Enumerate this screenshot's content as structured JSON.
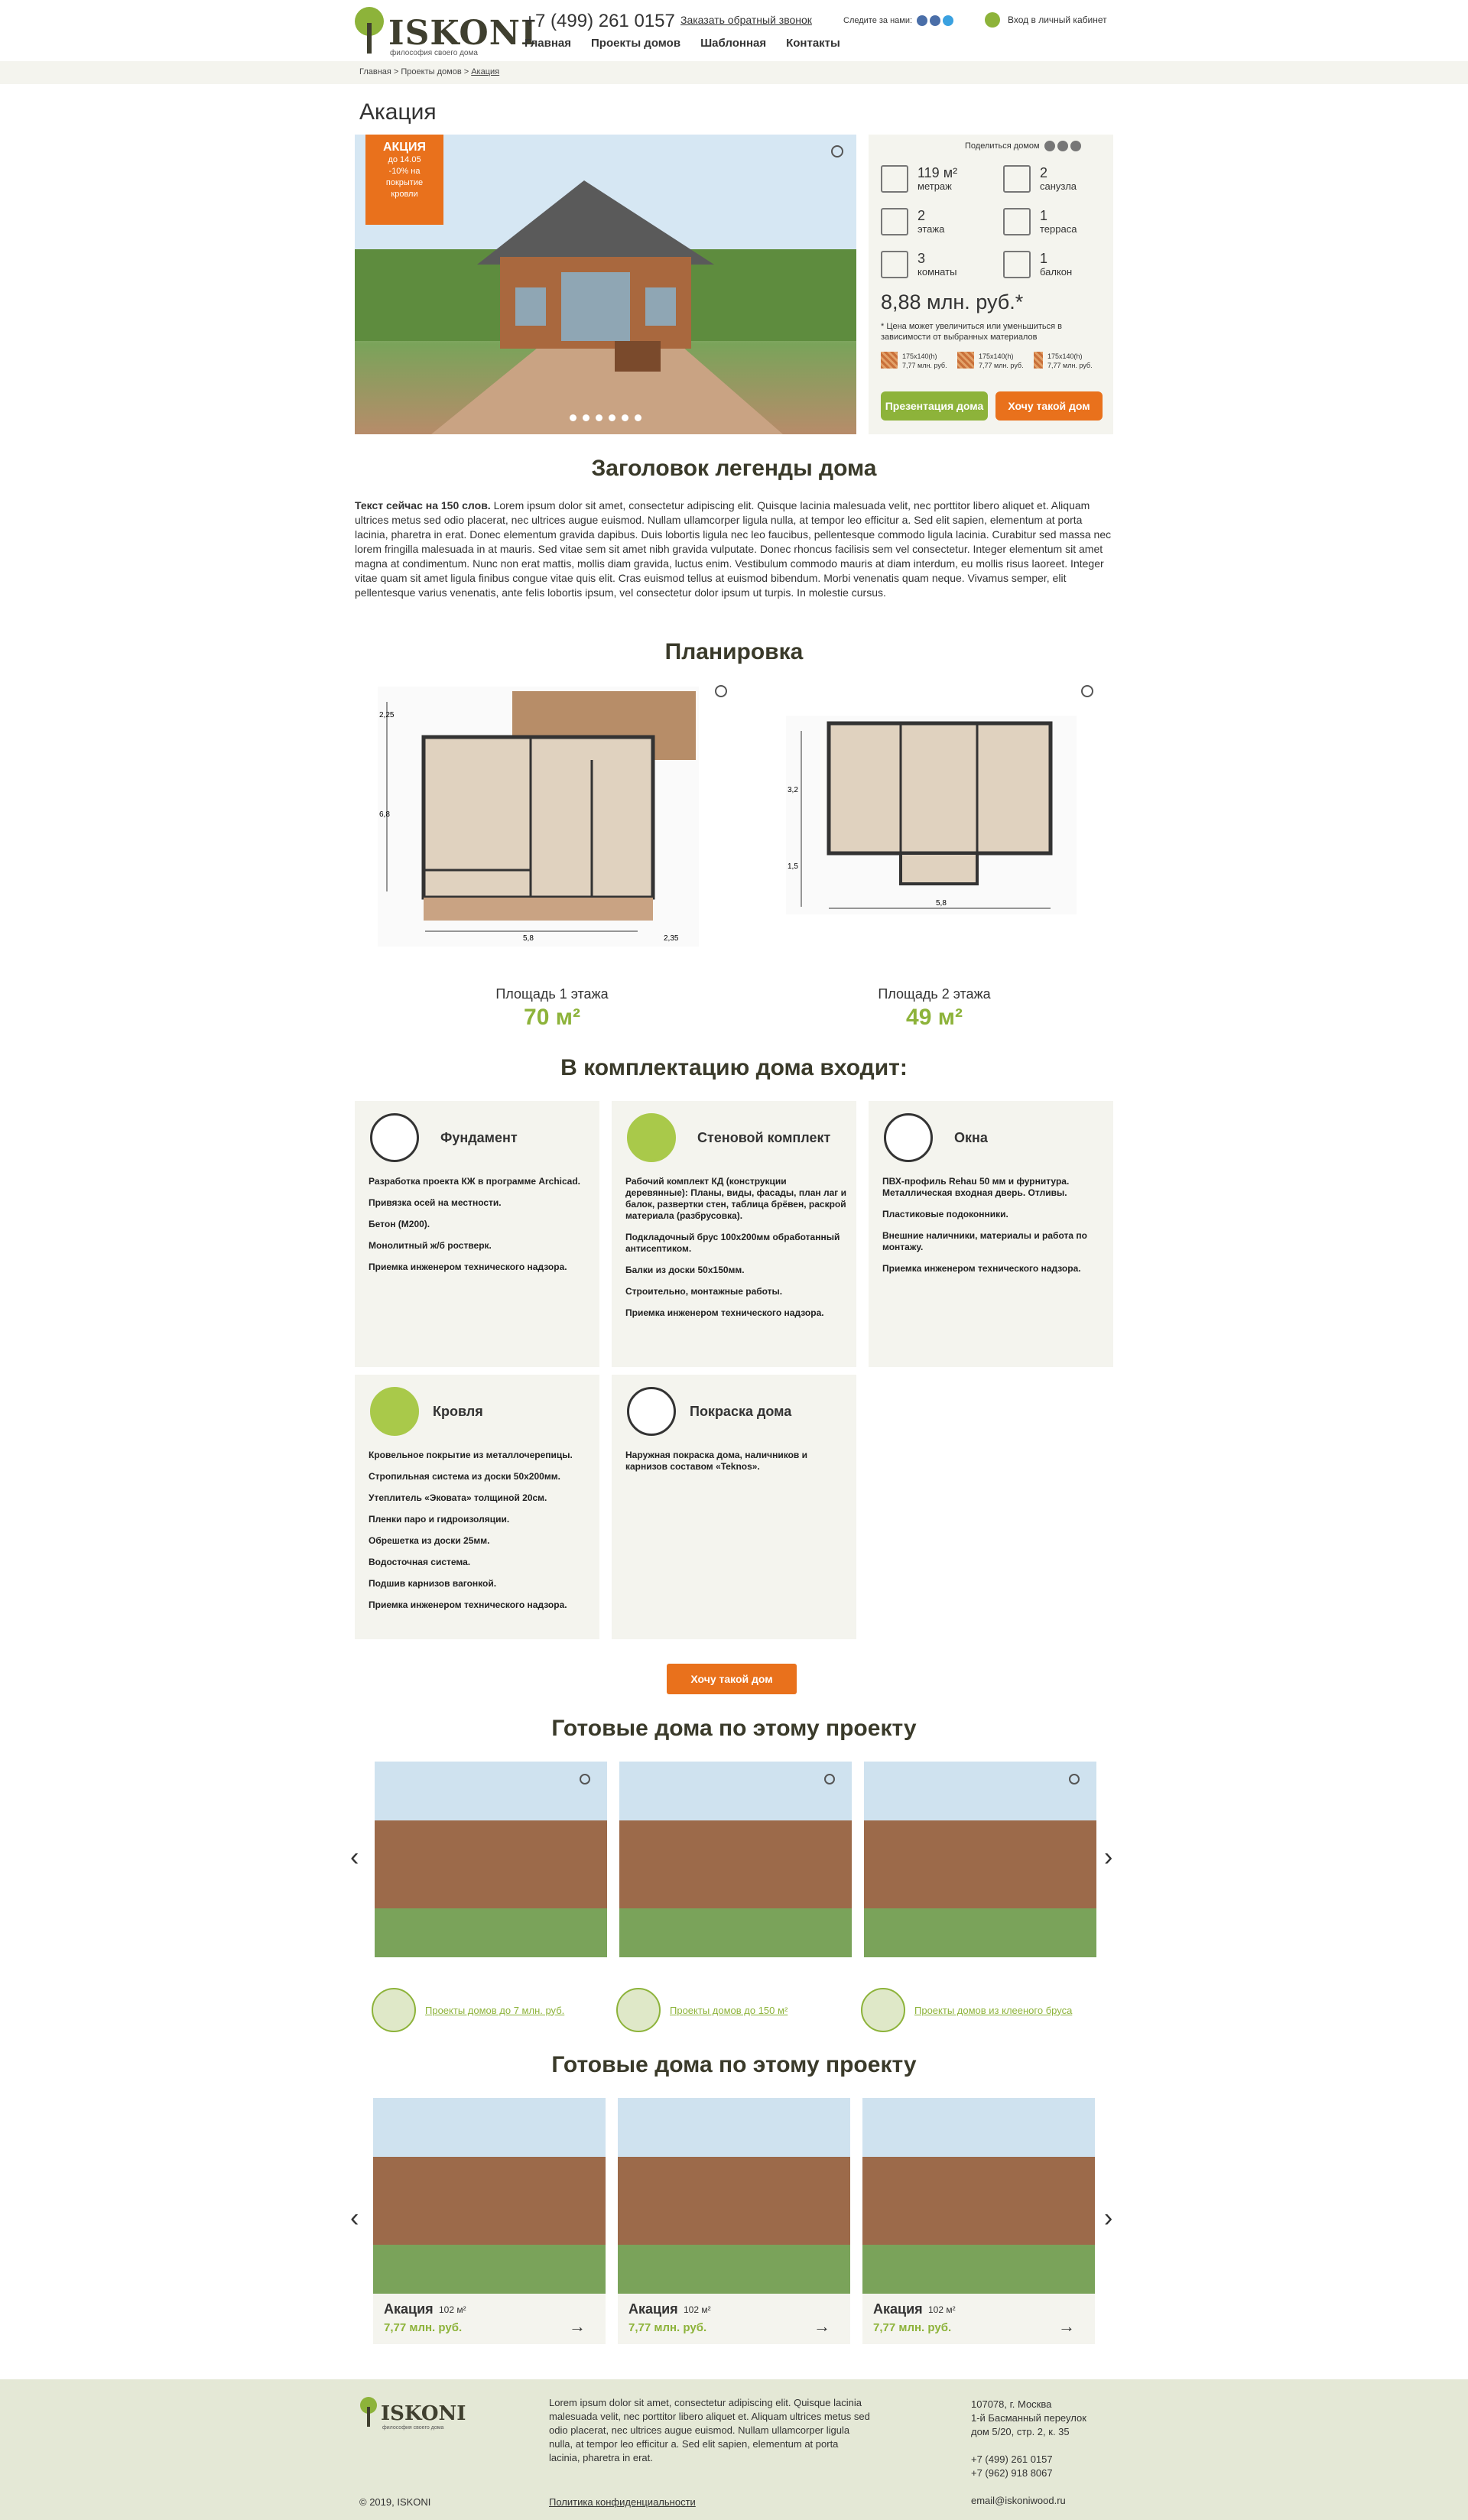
{
  "header": {
    "logo": "ISKONI",
    "logo_sub": "философия своего дома",
    "phone": "+7 (499) 261 0157",
    "callback": "Заказать обратный звонок",
    "nav": [
      "Главная",
      "Проекты домов",
      "Шаблонная",
      "Контакты"
    ],
    "follow": "Следите за нами:",
    "cabinet": "Вход в личный кабинет"
  },
  "breadcrumbs": {
    "path": "Главная > Проекты домов > ",
    "current": "Акация"
  },
  "title": "Акация",
  "promo": {
    "label": "АКЦИЯ",
    "line1": "до 14.05",
    "line2": "-10% на",
    "line3": "покрытие",
    "line4": "кровли"
  },
  "share": "Поделиться домом",
  "specs": [
    {
      "value": "119 м²",
      "label": "метраж",
      "icon": "area-icon"
    },
    {
      "value": "2",
      "label": "санузла",
      "icon": "toilet-icon"
    },
    {
      "value": "2",
      "label": "этажа",
      "icon": "floors-icon"
    },
    {
      "value": "1",
      "label": "терраса",
      "icon": "terrace-icon"
    },
    {
      "value": "3",
      "label": "комнаты",
      "icon": "rooms-icon"
    },
    {
      "value": "1",
      "label": "балкон",
      "icon": "balcony-icon"
    }
  ],
  "price": "8,88 млн. руб.*",
  "price_note": "* Цена может увеличиться или уменьшиться в зависимости от выбранных материалов",
  "materials": [
    {
      "size": "175х140(h)",
      "price": "7,77 млн. руб."
    },
    {
      "size": "175х140(h)",
      "price": "7,77 млн. руб."
    },
    {
      "size": "175х140(h)",
      "price": "7,77 млн. руб."
    }
  ],
  "buttons": {
    "presentation": "Презентация дома",
    "want": "Хочу такой дом",
    "want2": "Хочу такой дом"
  },
  "legend": {
    "heading": "Заголовок легенды дома",
    "lead": "Текст сейчас на 150 слов.",
    "text": " Lorem ipsum dolor sit amet, consectetur adipiscing elit. Quisque lacinia malesuada velit, nec porttitor libero aliquet et. Aliquam ultrices metus sed odio placerat, nec ultrices augue euismod. Nullam ullamcorper ligula nulla, at tempor leo efficitur a. Sed elit sapien, elementum at porta lacinia, pharetra in erat. Donec elementum gravida dapibus. Duis lobortis ligula nec leo faucibus, pellentesque commodo ligula lacinia. Curabitur sed massa nec lorem fringilla malesuada in at mauris. Sed vitae sem sit amet nibh gravida vulputate. Donec rhoncus facilisis sem vel consectetur. Integer elementum sit amet magna at condimentum. Nunc non erat mattis, mollis diam gravida, luctus enim. Vestibulum commodo mauris at diam interdum, eu mollis risus laoreet. Integer vitae quam sit amet ligula finibus congue vitae quis elit. Cras euismod tellus at euismod bibendum. Morbi venenatis quam neque. Vivamus semper, elit pellentesque varius venenatis, ante felis lobortis ipsum, vel consectetur dolor ipsum ut turpis. In molestie cursus."
  },
  "plan": {
    "heading": "Планировка",
    "floor1_label": "Площадь 1 этажа",
    "floor1_value": "70 м²",
    "floor2_label": "Площадь 2 этажа",
    "floor2_value": "49 м²",
    "dims": {
      "a": "2,25",
      "b": "6,8",
      "c": "5,8",
      "d": "2,35",
      "e": "3,2",
      "f": "1,5",
      "g": "5,8"
    }
  },
  "kit": {
    "heading": "В комплектацию дома входит:",
    "cards": [
      {
        "title": "Фундамент",
        "icon": "foundation-icon",
        "items": [
          "Разработка проекта КЖ в программе Archicad.",
          "Привязка осей на местности.",
          "Бетон (М200).",
          "Монолитный ж/б ростверк.",
          "Приемка инженером технического надзора."
        ]
      },
      {
        "title": "Стеновой комплект",
        "icon": "wall-kit-icon",
        "items": [
          "Рабочий комплект КД (конструкции деревянные): Планы, виды, фасады, план лаг и балок, развертки стен, таблица брёвен, раскрой материала (разбрусовка).",
          "Подкладочный брус 100х200мм обработанный антисептиком.",
          "Балки из доски 50х150мм.",
          "Строительно, монтажные работы.",
          "Приемка инженером технического надзора."
        ]
      },
      {
        "title": "Окна",
        "icon": "window-icon",
        "items": [
          "ПВХ-профиль Rehau 50 мм и фурнитура. Металлическая входная дверь. Отливы.",
          "Пластиковые подоконники.",
          "Внешние наличники, материалы и работа по монтажу.",
          "Приемка инженером технического надзора."
        ]
      },
      {
        "title": "Кровля",
        "icon": "roof-icon",
        "items": [
          "Кровельное покрытие из металлочерепицы.",
          "Стропильная система из доски 50х200мм.",
          "Утеплитель «Эковата» толщиной 20см.",
          "Пленки паро и гидроизоляции.",
          "Обрешетка из доски 25мм.",
          "Водосточная система.",
          "Подшив карнизов вагонкой.",
          "Приемка инженером технического надзора."
        ]
      },
      {
        "title": "Покраска дома",
        "icon": "paint-icon",
        "items": [
          "Наружная покраска дома, наличников и карнизов составом «Teknos»."
        ]
      }
    ]
  },
  "ready1": {
    "heading": "Готовые дома по этому проекту"
  },
  "categories": [
    "Проекты домов до 7 млн. руб.",
    "Проекты домов до 150  м²",
    "Проекты домов из клееного бруса"
  ],
  "ready2": {
    "heading": "Готовые дома по этому проекту",
    "cards": [
      {
        "title": "Акация",
        "size": "102 м²",
        "price": "7,77 млн. руб."
      },
      {
        "title": "Акация",
        "size": "102 м²",
        "price": "7,77 млн. руб."
      },
      {
        "title": "Акация",
        "size": "102 м²",
        "price": "7,77 млн. руб."
      }
    ]
  },
  "footer": {
    "logo": "ISKONI",
    "logo_sub": "философия своего дома",
    "text": "Lorem ipsum dolor sit amet, consectetur adipiscing elit. Quisque lacinia malesuada velit, nec porttitor libero aliquet et. Aliquam ultrices metus sed odio placerat, nec ultrices augue euismod. Nullam ullamcorper ligula nulla, at tempor leo efficitur a. Sed elit sapien, elementum at porta lacinia, pharetra in erat.",
    "address1": "107078, г. Москва",
    "address2": "1-й Басманный переулок",
    "address3": "дом 5/20, стр. 2, к. 35",
    "phone1": "+7 (499) 261 0157",
    "phone2": "+7 (962) 918 8067",
    "email": "email@iskoniwood.ru",
    "copyright": "© 2019, ISKONI",
    "privacy": "Политика конфиденциальности"
  },
  "colors": {
    "accent_green": "#8db33a",
    "accent_orange": "#e9711c",
    "panel": "#f4f4ee"
  }
}
